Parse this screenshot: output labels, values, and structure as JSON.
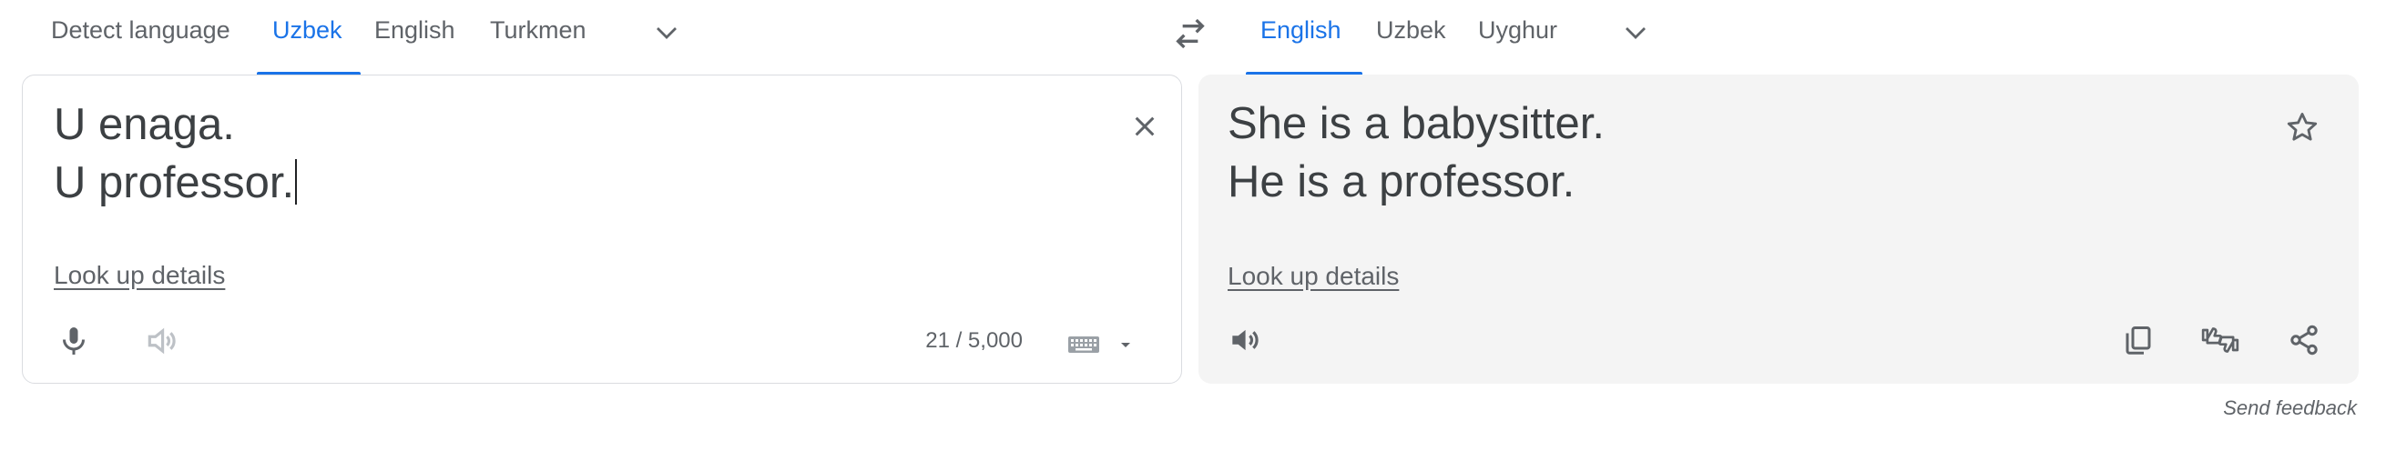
{
  "source_languages": {
    "tabs": [
      "Detect language",
      "Uzbek",
      "English",
      "Turkmen"
    ],
    "active": "Uzbek"
  },
  "target_languages": {
    "tabs": [
      "English",
      "Uzbek",
      "Uyghur"
    ],
    "active": "English"
  },
  "source": {
    "lines": [
      "U enaga.",
      "U professor."
    ],
    "look_up_details": "Look up details",
    "char_counter": "21 / 5,000"
  },
  "target": {
    "lines": [
      "She is a babysitter.",
      "He is a professor."
    ],
    "look_up_details": "Look up details"
  },
  "footer": {
    "send_feedback": "Send feedback"
  },
  "icons": {
    "swap": "swap-languages-icon",
    "more_source": "chevron-down-icon",
    "more_target": "chevron-down-icon",
    "clear": "close-icon",
    "mic": "microphone-icon",
    "listen_source": "speaker-icon",
    "keyboard": "keyboard-icon",
    "listen_target": "speaker-icon",
    "star": "star-icon",
    "copy": "copy-icon",
    "rate": "thumbs-rate-icon",
    "share": "share-icon"
  },
  "colors": {
    "accent": "#1a73e8",
    "text": "#3c4043",
    "muted": "#5f6368",
    "target_bg": "#f4f4f4"
  }
}
